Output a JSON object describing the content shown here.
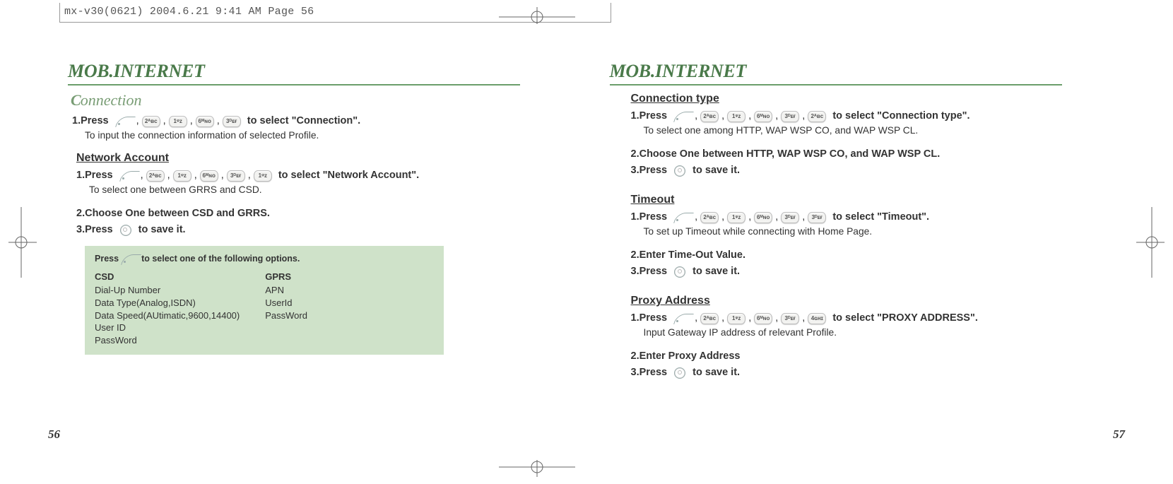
{
  "print_header": "mx-v30(0621)  2004.6.21  9:41 AM  Page 56",
  "left": {
    "chapter": "MOB.INTERNET",
    "section": "Connection",
    "s1_label": "1.Press",
    "s1_keys": [
      "2ᴬʙᴄ",
      "1ᵠᴢ",
      "6ᴹɴᴏ",
      "3ᴰᴇғ"
    ],
    "s1_tail": "to select \"Connection\".",
    "s1_desc": "To input the connection information of selected Profile.",
    "na_heading": "Network Account",
    "na1_label": "1.Press",
    "na1_keys": [
      "2ᴬʙᴄ",
      "1ᵠᴢ",
      "6ᴹɴᴏ",
      "3ᴰᴇғ",
      "1ᵠᴢ"
    ],
    "na1_tail": "to select \"Network Account\".",
    "na1_desc": "To select one between GRRS and CSD.",
    "na2": "2.Choose One between CSD and GRRS.",
    "na3_a": "3.Press",
    "na3_b": "to save it.",
    "tip_head_a": "Press",
    "tip_head_b": "to select one of the following options.",
    "tip_col1_title": "CSD",
    "tip_col1_lines": [
      "Dial-Up Number",
      "Data Type(Analog,ISDN)",
      "Data Speed(AUtimatic,9600,14400)",
      "User ID",
      "PassWord"
    ],
    "tip_col2_title": "GPRS",
    "tip_col2_lines": [
      "APN",
      "UserId",
      "PassWord"
    ],
    "pagenum": "56"
  },
  "right": {
    "chapter": "MOB.INTERNET",
    "ct_heading": "Connection type",
    "ct1_label": "1.Press",
    "ct1_keys": [
      "2ᴬʙᴄ",
      "1ᵠᴢ",
      "6ᴹɴᴏ",
      "3ᴰᴇғ",
      "2ᴬʙᴄ"
    ],
    "ct1_tail": "to select \"Connection type\".",
    "ct1_desc": "To select one among HTTP, WAP WSP CO, and WAP WSP CL.",
    "ct2": "2.Choose One between HTTP, WAP WSP CO, and WAP WSP CL.",
    "ct3_a": "3.Press",
    "ct3_b": "to save it.",
    "to_heading": "Timeout",
    "to1_label": "1.Press",
    "to1_keys": [
      "2ᴬʙᴄ",
      "1ᵠᴢ",
      "6ᴹɴᴏ",
      "3ᴰᴇғ",
      "3ᴰᴇғ"
    ],
    "to1_tail": "to select \"Timeout\".",
    "to1_desc": "To set up Timeout while connecting with Home Page.",
    "to2": "2.Enter Time-Out Value.",
    "to3_a": "3.Press",
    "to3_b": "to save it.",
    "pa_heading": "Proxy Address",
    "pa1_label": "1.Press",
    "pa1_keys": [
      "2ᴬʙᴄ",
      "1ᵠᴢ",
      "6ᴹɴᴏ",
      "3ᴰᴇғ",
      "4ɢʜɪ"
    ],
    "pa1_tail": "to select \"PROXY ADDRESS\".",
    "pa1_desc": "Input Gateway IP address of relevant Profile.",
    "pa2": "2.Enter Proxy Address",
    "pa3_a": "3.Press",
    "pa3_b": "to save it.",
    "pagenum": "57"
  }
}
